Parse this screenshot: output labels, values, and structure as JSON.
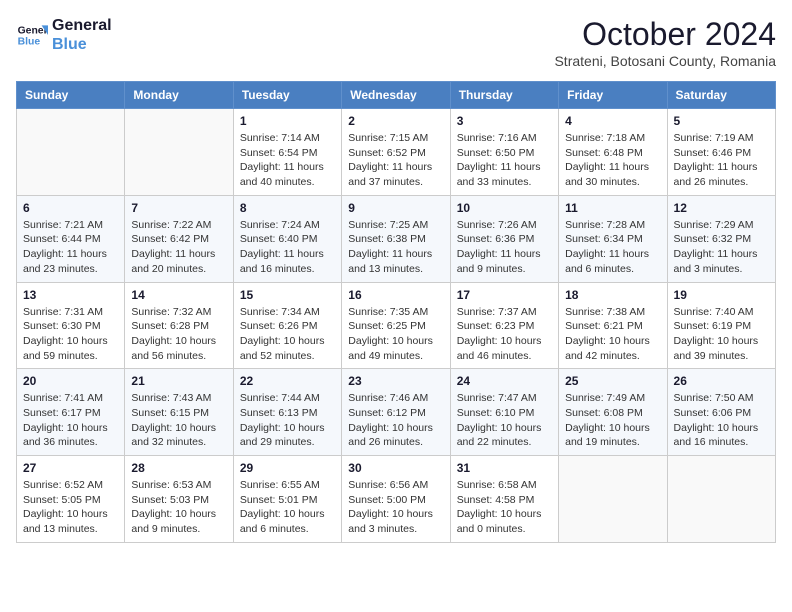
{
  "logo": {
    "line1": "General",
    "line2": "Blue"
  },
  "title": "October 2024",
  "subtitle": "Strateni, Botosani County, Romania",
  "weekdays": [
    "Sunday",
    "Monday",
    "Tuesday",
    "Wednesday",
    "Thursday",
    "Friday",
    "Saturday"
  ],
  "weeks": [
    [
      {
        "day": "",
        "info": ""
      },
      {
        "day": "",
        "info": ""
      },
      {
        "day": "1",
        "info": "Sunrise: 7:14 AM\nSunset: 6:54 PM\nDaylight: 11 hours and 40 minutes."
      },
      {
        "day": "2",
        "info": "Sunrise: 7:15 AM\nSunset: 6:52 PM\nDaylight: 11 hours and 37 minutes."
      },
      {
        "day": "3",
        "info": "Sunrise: 7:16 AM\nSunset: 6:50 PM\nDaylight: 11 hours and 33 minutes."
      },
      {
        "day": "4",
        "info": "Sunrise: 7:18 AM\nSunset: 6:48 PM\nDaylight: 11 hours and 30 minutes."
      },
      {
        "day": "5",
        "info": "Sunrise: 7:19 AM\nSunset: 6:46 PM\nDaylight: 11 hours and 26 minutes."
      }
    ],
    [
      {
        "day": "6",
        "info": "Sunrise: 7:21 AM\nSunset: 6:44 PM\nDaylight: 11 hours and 23 minutes."
      },
      {
        "day": "7",
        "info": "Sunrise: 7:22 AM\nSunset: 6:42 PM\nDaylight: 11 hours and 20 minutes."
      },
      {
        "day": "8",
        "info": "Sunrise: 7:24 AM\nSunset: 6:40 PM\nDaylight: 11 hours and 16 minutes."
      },
      {
        "day": "9",
        "info": "Sunrise: 7:25 AM\nSunset: 6:38 PM\nDaylight: 11 hours and 13 minutes."
      },
      {
        "day": "10",
        "info": "Sunrise: 7:26 AM\nSunset: 6:36 PM\nDaylight: 11 hours and 9 minutes."
      },
      {
        "day": "11",
        "info": "Sunrise: 7:28 AM\nSunset: 6:34 PM\nDaylight: 11 hours and 6 minutes."
      },
      {
        "day": "12",
        "info": "Sunrise: 7:29 AM\nSunset: 6:32 PM\nDaylight: 11 hours and 3 minutes."
      }
    ],
    [
      {
        "day": "13",
        "info": "Sunrise: 7:31 AM\nSunset: 6:30 PM\nDaylight: 10 hours and 59 minutes."
      },
      {
        "day": "14",
        "info": "Sunrise: 7:32 AM\nSunset: 6:28 PM\nDaylight: 10 hours and 56 minutes."
      },
      {
        "day": "15",
        "info": "Sunrise: 7:34 AM\nSunset: 6:26 PM\nDaylight: 10 hours and 52 minutes."
      },
      {
        "day": "16",
        "info": "Sunrise: 7:35 AM\nSunset: 6:25 PM\nDaylight: 10 hours and 49 minutes."
      },
      {
        "day": "17",
        "info": "Sunrise: 7:37 AM\nSunset: 6:23 PM\nDaylight: 10 hours and 46 minutes."
      },
      {
        "day": "18",
        "info": "Sunrise: 7:38 AM\nSunset: 6:21 PM\nDaylight: 10 hours and 42 minutes."
      },
      {
        "day": "19",
        "info": "Sunrise: 7:40 AM\nSunset: 6:19 PM\nDaylight: 10 hours and 39 minutes."
      }
    ],
    [
      {
        "day": "20",
        "info": "Sunrise: 7:41 AM\nSunset: 6:17 PM\nDaylight: 10 hours and 36 minutes."
      },
      {
        "day": "21",
        "info": "Sunrise: 7:43 AM\nSunset: 6:15 PM\nDaylight: 10 hours and 32 minutes."
      },
      {
        "day": "22",
        "info": "Sunrise: 7:44 AM\nSunset: 6:13 PM\nDaylight: 10 hours and 29 minutes."
      },
      {
        "day": "23",
        "info": "Sunrise: 7:46 AM\nSunset: 6:12 PM\nDaylight: 10 hours and 26 minutes."
      },
      {
        "day": "24",
        "info": "Sunrise: 7:47 AM\nSunset: 6:10 PM\nDaylight: 10 hours and 22 minutes."
      },
      {
        "day": "25",
        "info": "Sunrise: 7:49 AM\nSunset: 6:08 PM\nDaylight: 10 hours and 19 minutes."
      },
      {
        "day": "26",
        "info": "Sunrise: 7:50 AM\nSunset: 6:06 PM\nDaylight: 10 hours and 16 minutes."
      }
    ],
    [
      {
        "day": "27",
        "info": "Sunrise: 6:52 AM\nSunset: 5:05 PM\nDaylight: 10 hours and 13 minutes."
      },
      {
        "day": "28",
        "info": "Sunrise: 6:53 AM\nSunset: 5:03 PM\nDaylight: 10 hours and 9 minutes."
      },
      {
        "day": "29",
        "info": "Sunrise: 6:55 AM\nSunset: 5:01 PM\nDaylight: 10 hours and 6 minutes."
      },
      {
        "day": "30",
        "info": "Sunrise: 6:56 AM\nSunset: 5:00 PM\nDaylight: 10 hours and 3 minutes."
      },
      {
        "day": "31",
        "info": "Sunrise: 6:58 AM\nSunset: 4:58 PM\nDaylight: 10 hours and 0 minutes."
      },
      {
        "day": "",
        "info": ""
      },
      {
        "day": "",
        "info": ""
      }
    ]
  ]
}
